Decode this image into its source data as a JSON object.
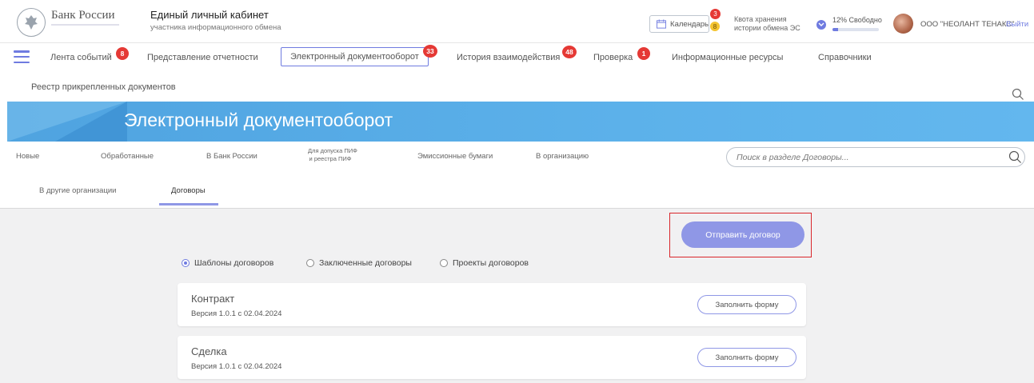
{
  "header": {
    "bank_name": "Банк России",
    "cabinet_title": "Единый личный кабинет",
    "cabinet_subtitle": "участника информационного обмена",
    "calendar_label": "Календарь",
    "calendar_badge_red": "3",
    "calendar_badge_yellow": "8",
    "quota_label": "Квота хранения истории обмена ЭС",
    "quota_free": "12% Свободно",
    "quota_free_fraction": 0.12,
    "org_name": "ООО \"НЕОЛАНТ ТЕНАКС\"",
    "logout": "Выйти"
  },
  "nav": {
    "items": [
      {
        "label": "Лента событий",
        "badge": "8"
      },
      {
        "label": "Представление отчетности",
        "badge": ""
      },
      {
        "label": "Электронный документооборот",
        "badge": "33"
      },
      {
        "label": "История взаимодействия",
        "badge": "48"
      },
      {
        "label": "Проверка",
        "badge": "1"
      },
      {
        "label": "Информационные ресурсы",
        "badge": ""
      },
      {
        "label": "Справочники",
        "badge": ""
      }
    ],
    "sub_item": "Реестр прикрепленных документов"
  },
  "banner": {
    "title": "Электронный документооборот"
  },
  "section_tabs": {
    "row1": [
      "Новые",
      "Обработанные",
      "В Банк России",
      "Для допуска ПИФ",
      "и реестра ПИФ",
      "Эмиссионные бумаги",
      "В организацию"
    ],
    "row2": [
      "В другие организации",
      "Договоры"
    ],
    "search_placeholder": "Поиск в разделе Договоры..."
  },
  "content": {
    "send_button": "Отправить договор",
    "radios": [
      "Шаблоны договоров",
      "Заключенные договоры",
      "Проекты договоров"
    ],
    "cards": [
      {
        "title": "Контракт",
        "version": "Версия 1.0.1 с 02.04.2024",
        "button": "Заполнить форму"
      },
      {
        "title": "Сделка",
        "version": "Версия 1.0.1 с 02.04.2024",
        "button": "Заполнить форму"
      }
    ]
  },
  "colors": {
    "accent": "#6f7be0",
    "button": "#8f97e6",
    "badge": "#e53935",
    "banner": "#5cb1ea",
    "highlight": "#d9262b"
  }
}
